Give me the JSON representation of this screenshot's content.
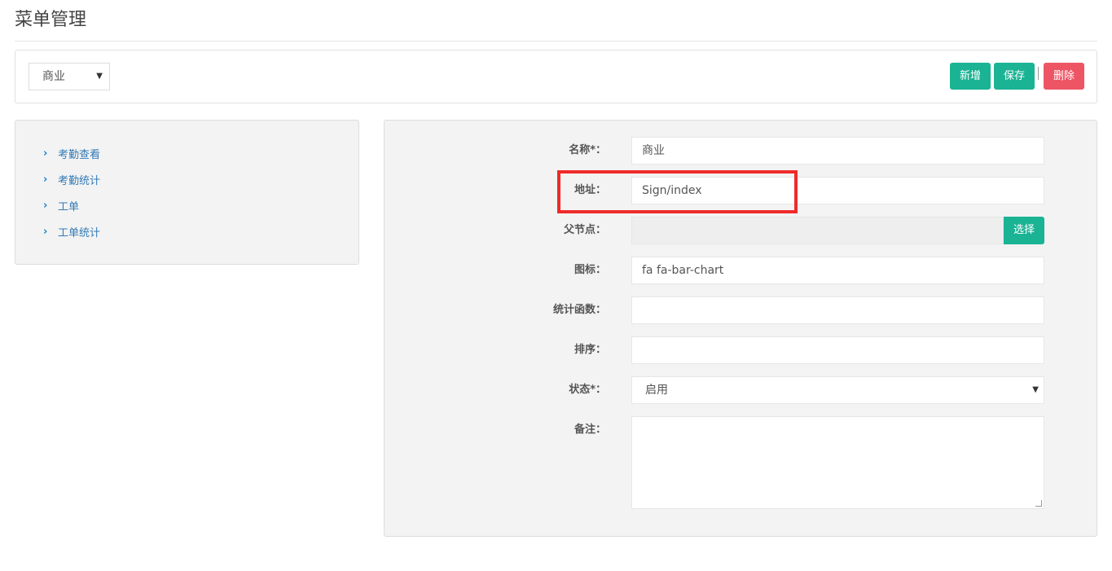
{
  "page": {
    "title": "菜单管理"
  },
  "toolbar": {
    "category_value": "商业",
    "add_label": "新增",
    "save_label": "保存",
    "delete_label": "删除",
    "colors": {
      "primary": "#1ab394",
      "danger": "#ed5565"
    }
  },
  "tree": {
    "items": [
      {
        "label": "考勤查看"
      },
      {
        "label": "考勤统计"
      },
      {
        "label": "工单"
      },
      {
        "label": "工单统计"
      }
    ]
  },
  "form": {
    "name": {
      "label": "名称*：",
      "value": "商业"
    },
    "address": {
      "label": "地址：",
      "value": "Sign/index"
    },
    "parent": {
      "label": "父节点：",
      "value": "",
      "button_label": "选择"
    },
    "icon": {
      "label": "图标：",
      "value": "fa fa-bar-chart"
    },
    "stat_func": {
      "label": "统计函数：",
      "value": ""
    },
    "sort": {
      "label": "排序：",
      "value": ""
    },
    "status": {
      "label": "状态*：",
      "value": "启用"
    },
    "remark": {
      "label": "备注：",
      "value": ""
    }
  },
  "annotation": {
    "color": "#ef2b2b"
  }
}
